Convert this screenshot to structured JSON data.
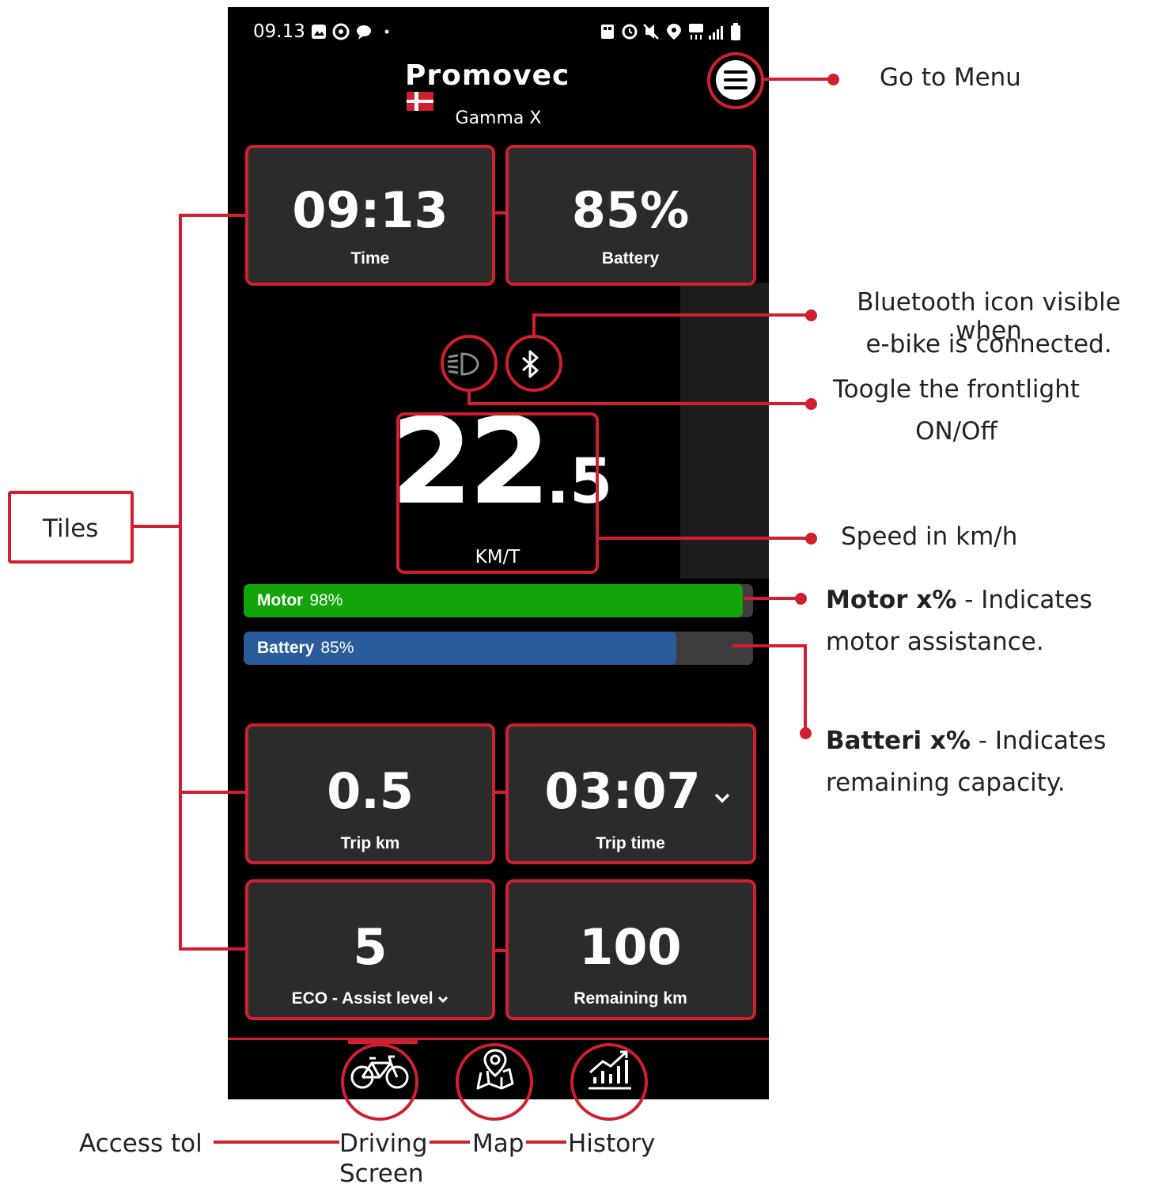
{
  "status_bar": {
    "time": "09.13"
  },
  "header": {
    "brand": "Promovec",
    "model": "Gamma X"
  },
  "tiles": {
    "time": {
      "value": "09:13",
      "label": "Time"
    },
    "battery": {
      "value": "85%",
      "label": "Battery"
    },
    "trip_km": {
      "value": "0.5",
      "label": "Trip km"
    },
    "trip_time": {
      "value": "03:07",
      "label": "Trip time"
    },
    "assist": {
      "value": "5",
      "label": "ECO - Assist level"
    },
    "remaining": {
      "value": "100",
      "label": "Remaining km"
    }
  },
  "speed": {
    "integer": "22",
    "decimal": ".5",
    "unit": "KM/T"
  },
  "bars": {
    "motor": {
      "name": "Motor",
      "value_text": "98%",
      "level": 0.98,
      "color": "#12a40a"
    },
    "battery": {
      "name": "Battery",
      "value_text": "85%",
      "level": 0.85,
      "color": "#2a5b9a"
    }
  },
  "nav": {
    "items": [
      "bike-icon",
      "map-icon",
      "history-icon"
    ]
  },
  "annotations": {
    "menu": "Go to Menu",
    "bluetooth_l1": "Bluetooth icon visible when",
    "bluetooth_l2": "e-bike is connected.",
    "light_l1": "Toogle the frontlight",
    "light_l2": "ON/Off",
    "speed": "Speed in km/h",
    "motor_bold": "Motor x%",
    "motor_rest": " - Indicates",
    "motor_l2": "motor assistance.",
    "battery_bold": "Batteri x%",
    "battery_rest": " - Indicates",
    "battery_l2": "remaining capacity.",
    "tiles": "Tiles",
    "access": "Access tol",
    "driving_l1": "Driving",
    "driving_l2": "Screen",
    "map": "Map",
    "history": "History"
  },
  "colors": {
    "accent": "#d01f2f",
    "tile_bg": "#2b2b2b"
  }
}
